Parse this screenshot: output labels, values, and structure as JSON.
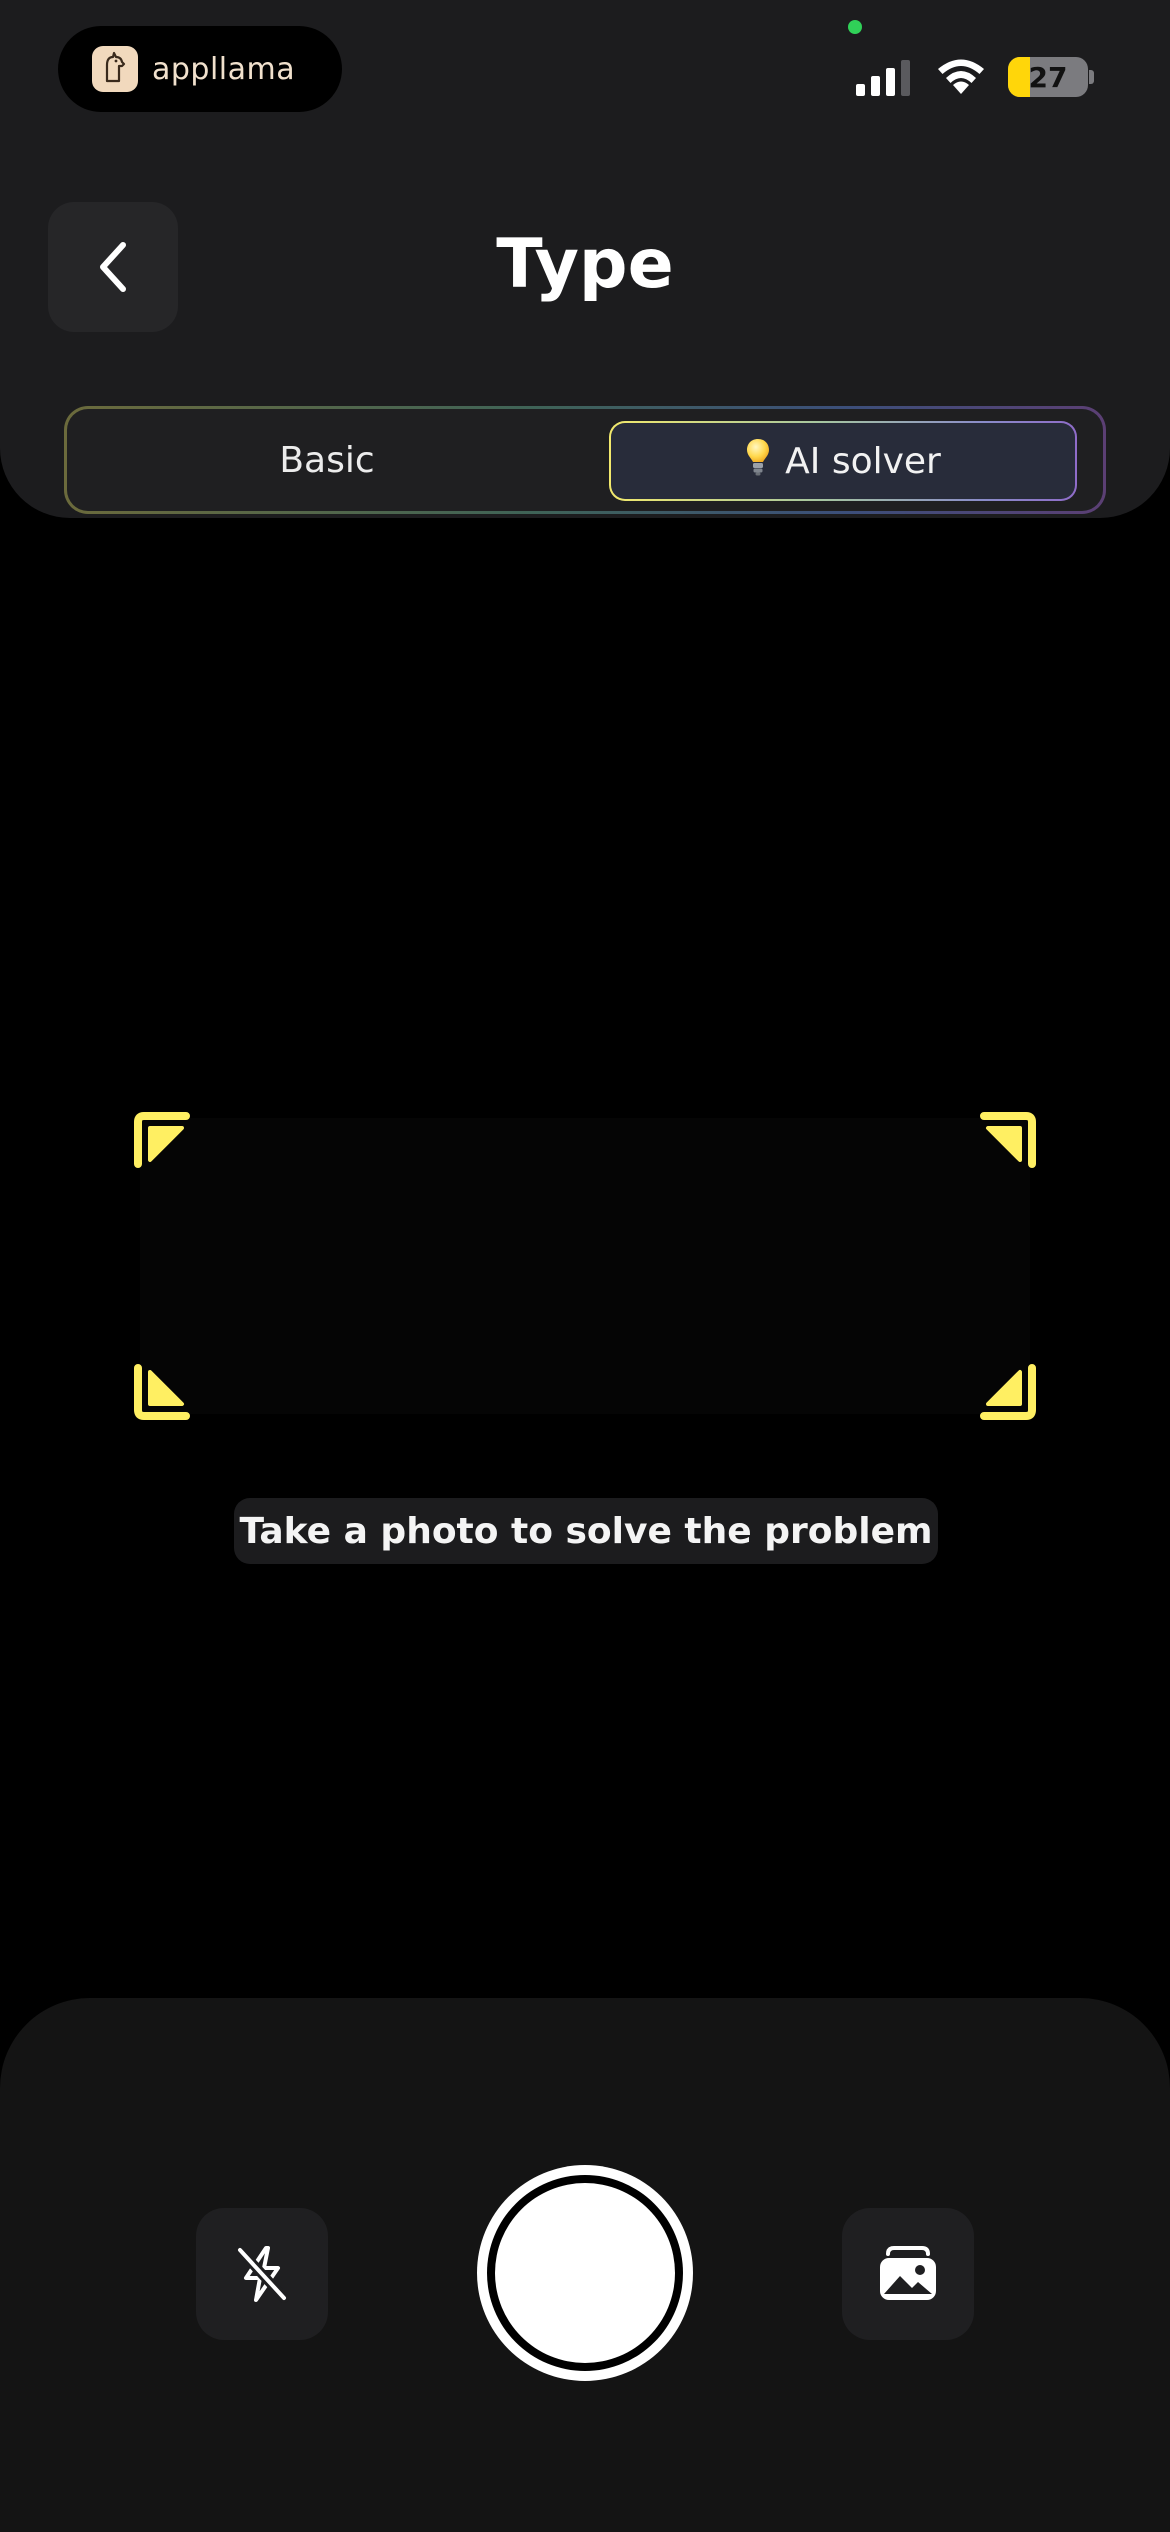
{
  "status_bar": {
    "app_name": "appllama",
    "battery_percent": "27",
    "battery_level": 0.27,
    "colors": {
      "privacy_dot": "#30d158",
      "battery_fill": "#ffd60a"
    }
  },
  "header": {
    "title": "Type",
    "back_icon": "chevron-left-icon"
  },
  "mode_tabs": {
    "basic_label": "Basic",
    "ai_label": "AI solver",
    "ai_icon": "lightbulb-icon",
    "selected": "AI solver"
  },
  "camera": {
    "hint": "Take a photo to solve the problem",
    "frame_color": "#ffef62"
  },
  "controls": {
    "flash_icon": "flash-off-icon",
    "gallery_icon": "photo-gallery-icon",
    "shutter_icon": "shutter-icon"
  }
}
